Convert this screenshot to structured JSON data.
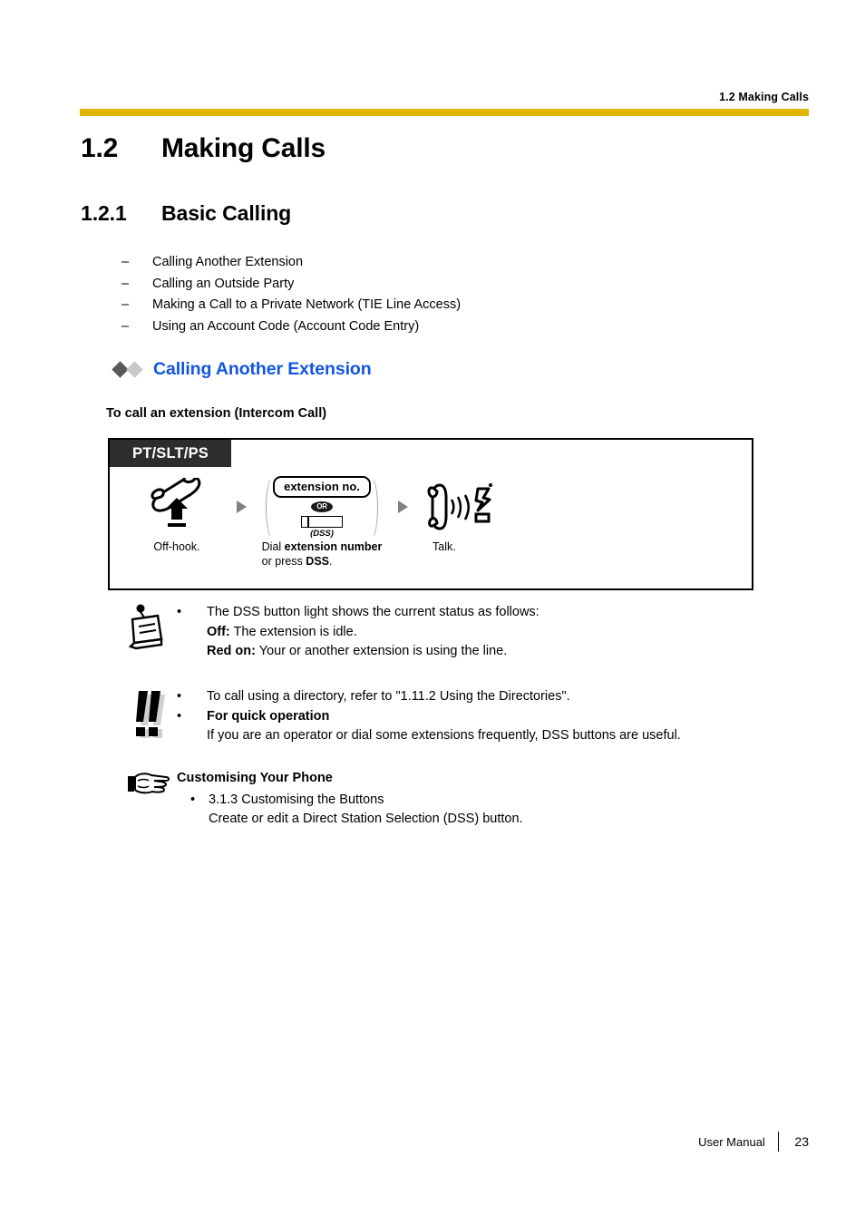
{
  "header": {
    "running_head": "1.2 Making Calls",
    "rule_color": "#e0b303"
  },
  "titles": {
    "h1_number": "1.2",
    "h1_text": "Making Calls",
    "h2_number": "1.2.1",
    "h2_text": "Basic Calling"
  },
  "topics": {
    "dash": "–",
    "items": [
      "Calling Another Extension",
      "Calling an Outside Party",
      "Making a Call to a Private Network (TIE Line Access)",
      "Using an Account Code (Account Code Entry)"
    ]
  },
  "section": {
    "heading": "Calling Another Extension",
    "heading_color": "#1255e0",
    "diamond_dark": "#595959",
    "diamond_light": "#c9c9c9",
    "subheading": "To call an extension (Intercom Call)"
  },
  "opbox": {
    "tab_label": "PT/SLT/PS",
    "tab_bg": "#2d2d2d",
    "steps": [
      {
        "icon": "offhook-handset-icon",
        "caption": "Off-hook."
      },
      {
        "icon": "extension-number-group",
        "pill_label": "extension no.",
        "or_label": "OR",
        "dss_key_label": "(DSS)",
        "caption_line1_prefix": "Dial ",
        "caption_line1_bold": "extension number",
        "caption_line2_prefix": "or press ",
        "caption_line2_bold": "DSS",
        "caption_line2_suffix": "."
      },
      {
        "icon": "talk-handset-icon",
        "caption": "Talk."
      }
    ],
    "arrow_glyph": "▶"
  },
  "notes": [
    {
      "icon": "note-pad-icon",
      "bullet": "•",
      "line1": "The DSS button light shows the current status as follows:",
      "line2_bold": "Off:",
      "line2_rest": " The extension is idle.",
      "line3_bold": "Red on:",
      "line3_rest": " Your or another extension is using the line."
    },
    {
      "icon": "double-exclamation-icon",
      "bullet": "•",
      "line1": "To call using a directory, refer to \"1.11.2 Using the Directories\".",
      "line2_bold": "For quick operation",
      "line3": "If you are an operator or dial some extensions frequently, DSS buttons are useful."
    },
    {
      "icon": "pointing-hand-icon",
      "title": "Customising Your Phone",
      "bullet": "•",
      "line1": "3.1.3 Customising the Buttons",
      "line2": "Create or edit a Direct Station Selection (DSS) button."
    }
  ],
  "footer": {
    "label": "User Manual",
    "page_number": "23"
  }
}
